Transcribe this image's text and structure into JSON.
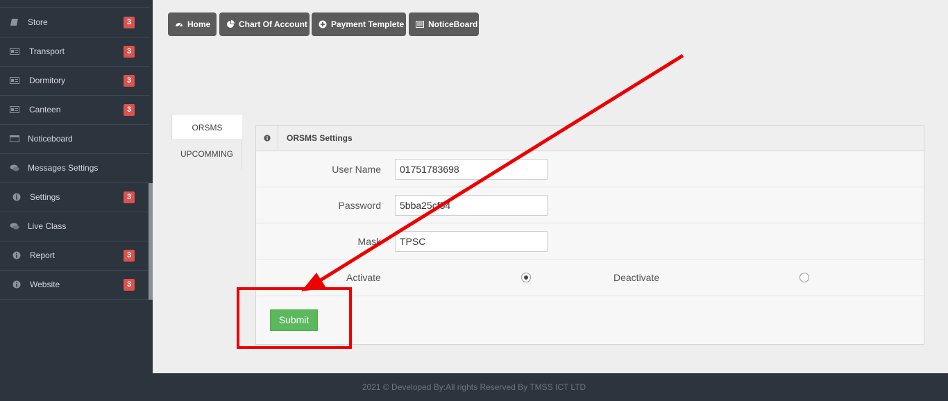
{
  "sidebar": {
    "items": [
      {
        "label": "Store",
        "icon": "book-icon",
        "badge": "3"
      },
      {
        "label": "Transport",
        "icon": "id-card-icon",
        "badge": "3"
      },
      {
        "label": "Dormitory",
        "icon": "id-card-icon",
        "badge": "3"
      },
      {
        "label": "Canteen",
        "icon": "id-card-icon",
        "badge": "3"
      },
      {
        "label": "Noticeboard",
        "icon": "window-icon",
        "badge": ""
      },
      {
        "label": "Messages Settings",
        "icon": "comments-icon",
        "badge": ""
      },
      {
        "label": "Settings",
        "icon": "info-icon",
        "badge": "3"
      },
      {
        "label": "Live Class",
        "icon": "comments-icon",
        "badge": ""
      },
      {
        "label": "Report",
        "icon": "info-icon",
        "badge": "3"
      },
      {
        "label": "Website",
        "icon": "info-icon",
        "badge": "3"
      }
    ]
  },
  "toolbar": {
    "home": "Home",
    "chart_of_account": "Chart Of Account",
    "payment_template": "Payment Templete",
    "noticeboard": "NoticeBoard"
  },
  "tabs": {
    "orsms": "ORSMS",
    "upcomming": "UPCOMMING"
  },
  "panel": {
    "title": "ORSMS Settings",
    "username_label": "User Name",
    "username_value": "01751783698",
    "password_label": "Password",
    "password_value": "5bba25cf54",
    "mask_label": "Mask",
    "mask_value": "TPSC",
    "activate_label": "Activate",
    "deactivate_label": "Deactivate",
    "selected_status": "Activate",
    "submit_label": "Submit"
  },
  "footer": {
    "text": "2021 © Developed By:All rights Reserved By TMSS ICT LTD"
  },
  "colors": {
    "sidebar_bg": "#2c343e",
    "badge": "#d9534f",
    "toolbar_button": "#5b5b5b",
    "submit": "#5cb85c",
    "annotation": "#ee0000"
  }
}
